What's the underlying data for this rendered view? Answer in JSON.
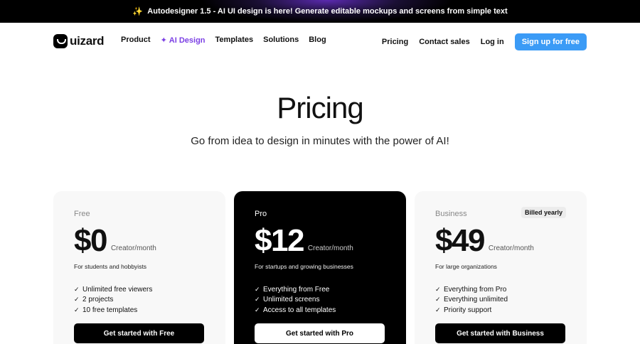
{
  "banner": {
    "icon": "sparkle-icon",
    "text": "Autodesigner 1.5 - AI UI design is here! Generate editable mockups and screens from simple text"
  },
  "nav": {
    "logo_text": "uizard",
    "items": [
      "Product",
      "AI Design",
      "Templates",
      "Solutions",
      "Blog"
    ],
    "right": [
      "Pricing",
      "Contact sales",
      "Log in"
    ],
    "signup": "Sign up for free"
  },
  "hero": {
    "title": "Pricing",
    "subtitle": "Go from idea to design in minutes with the power of AI!"
  },
  "plans": [
    {
      "name": "Free",
      "price": "$0",
      "per": "Creator/month",
      "desc": "For students and hobbyists",
      "features": [
        "Unlimited free viewers",
        "2 projects",
        "10 free templates"
      ],
      "cta": "Get started with Free"
    },
    {
      "name": "Pro",
      "price": "$12",
      "per": "Creator/month",
      "desc": "For startups and growing businesses",
      "features": [
        "Everything from Free",
        "Unlimited screens",
        "Access to all templates"
      ],
      "cta": "Get started with Pro"
    },
    {
      "name": "Business",
      "price": "$49",
      "per": "Creator/month",
      "desc": "For large organizations",
      "badge": "Billed yearly",
      "features": [
        "Everything from Pro",
        "Everything unlimited",
        "Priority support"
      ],
      "cta": "Get started with Business"
    }
  ],
  "colors": {
    "accent": "#3b9bf6",
    "ai_purple": "#7b3fe4",
    "card_bg": "#f8f8f8",
    "pro_bg": "#000000"
  }
}
